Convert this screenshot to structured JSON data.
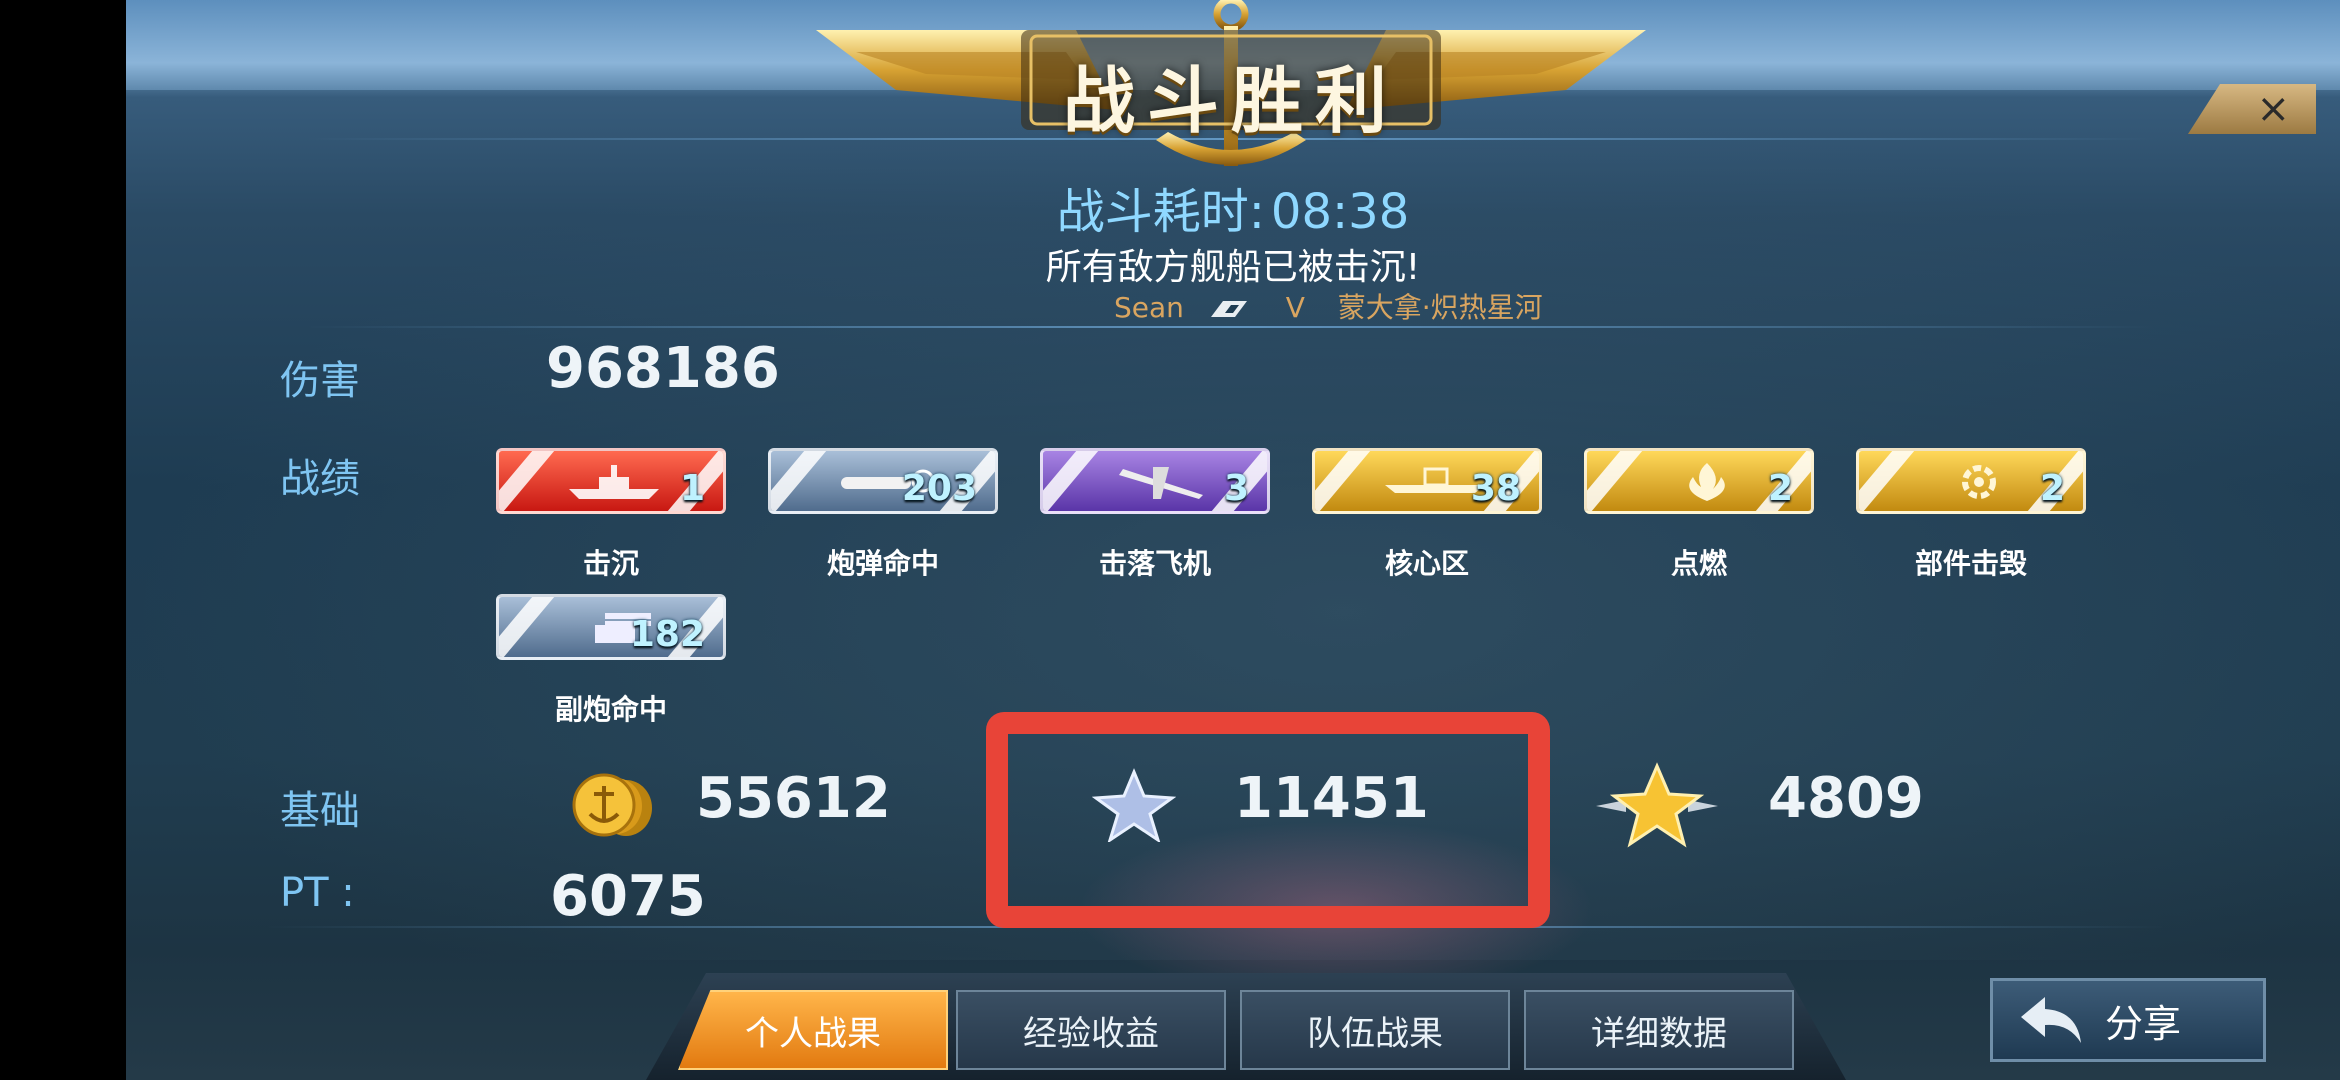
{
  "header": {
    "title": "战斗胜利",
    "close_label": "×",
    "time_label": "战斗耗时:",
    "time_value": "08:38",
    "message": "所有敌方舰船已被击沉!",
    "player_name": "Sean",
    "vs_label": "V",
    "enemy_name": "蒙大拿·炽热星河"
  },
  "damage": {
    "label": "伤害",
    "value": "968186"
  },
  "record": {
    "label": "战绩",
    "medals": [
      {
        "name": "击沉",
        "count": "1",
        "color": "red",
        "icon": "sink-ship-icon"
      },
      {
        "name": "炮弹命中",
        "count": "203",
        "color": "blue",
        "icon": "shell-hit-icon"
      },
      {
        "name": "击落飞机",
        "count": "3",
        "color": "purple",
        "icon": "plane-down-icon"
      },
      {
        "name": "核心区",
        "count": "38",
        "color": "gold",
        "icon": "citadel-icon"
      },
      {
        "name": "点燃",
        "count": "2",
        "color": "gold",
        "icon": "fire-icon"
      },
      {
        "name": "部件击毁",
        "count": "2",
        "color": "gold",
        "icon": "gear-broken-icon"
      },
      {
        "name": "副炮命中",
        "count": "182",
        "color": "blue",
        "icon": "secondary-gun-icon"
      }
    ]
  },
  "base": {
    "label": "基础",
    "coins": "55612",
    "exp": "11451",
    "rank_points": "4809"
  },
  "pt": {
    "label": "PT :",
    "value": "6075"
  },
  "tabs": [
    {
      "label": "个人战果",
      "active": true
    },
    {
      "label": "经验收益",
      "active": false
    },
    {
      "label": "队伍战果",
      "active": false
    },
    {
      "label": "详细数据",
      "active": false
    }
  ],
  "share_label": "分享",
  "colors": {
    "highlight": "#e84438",
    "label_blue": "#7fc5f2",
    "tab_active": "#f29a2a"
  }
}
